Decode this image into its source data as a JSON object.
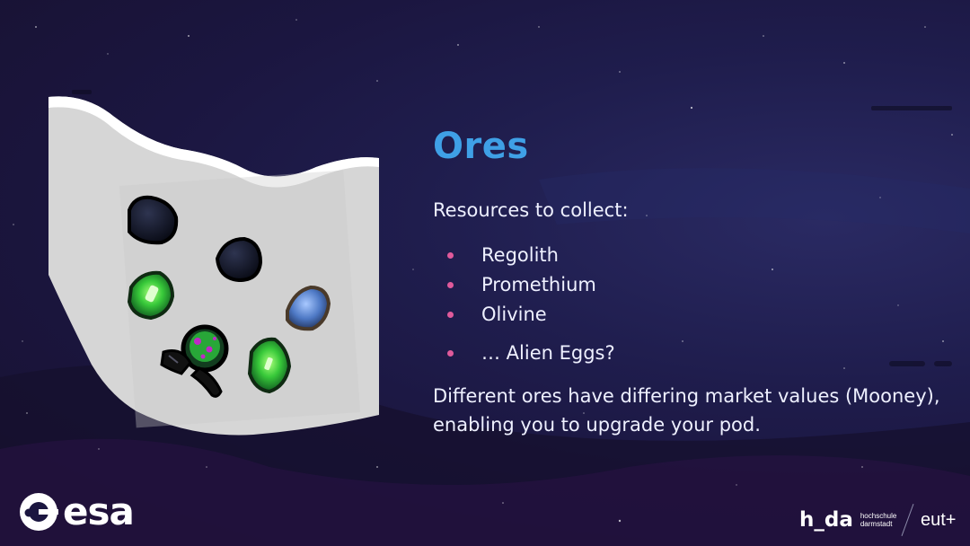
{
  "slide": {
    "title": "Ores",
    "intro": "Resources to collect:",
    "ores": [
      "Regolith",
      "Promethium",
      "Olivine",
      "… Alien Eggs?"
    ],
    "description": "Different ores have differing market values (Mooney), enabling you to upgrade your pod."
  },
  "image": {
    "icon": "ore-collection-image"
  },
  "logos": {
    "esa": "esa",
    "hda_main": "h_da",
    "hda_sub_line1": "hochschule",
    "hda_sub_line2": "darmstadt",
    "eut": "eut+"
  },
  "colors": {
    "title": "#3fa0e6",
    "bullet": "#e05a9b",
    "text": "#eef0ff",
    "background": "#1b1640"
  }
}
